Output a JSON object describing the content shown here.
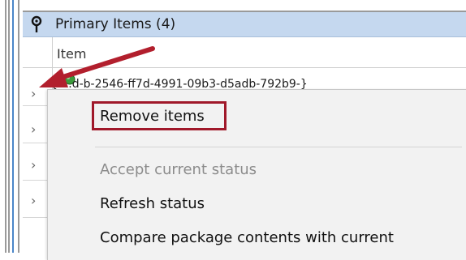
{
  "panel": {
    "title": "Primary Items (4)",
    "column_header": "Item",
    "first_row_partial_text": "{....d-b-2546-ff7d-4991-09b3-d5adb-792b9-}"
  },
  "rows": [
    {
      "expander": "›"
    },
    {
      "expander": "›"
    },
    {
      "expander": "›"
    },
    {
      "expander": "›"
    }
  ],
  "context_menu": {
    "items": [
      {
        "label": "Remove items",
        "enabled": true,
        "highlighted": true
      },
      {
        "label": "Accept current status",
        "enabled": false
      },
      {
        "label": "Refresh status",
        "enabled": true
      },
      {
        "label": "Compare package contents with current",
        "enabled": true
      }
    ]
  },
  "colors": {
    "header_bg": "#c5d8ef",
    "highlight_border": "#a0182a",
    "annotation_arrow": "#b21f2d",
    "menu_bg": "#f2f2f2",
    "disabled_text": "#8c8c8c"
  },
  "icons": {
    "header": "pin-icon",
    "row_status": "green-status-icon"
  }
}
